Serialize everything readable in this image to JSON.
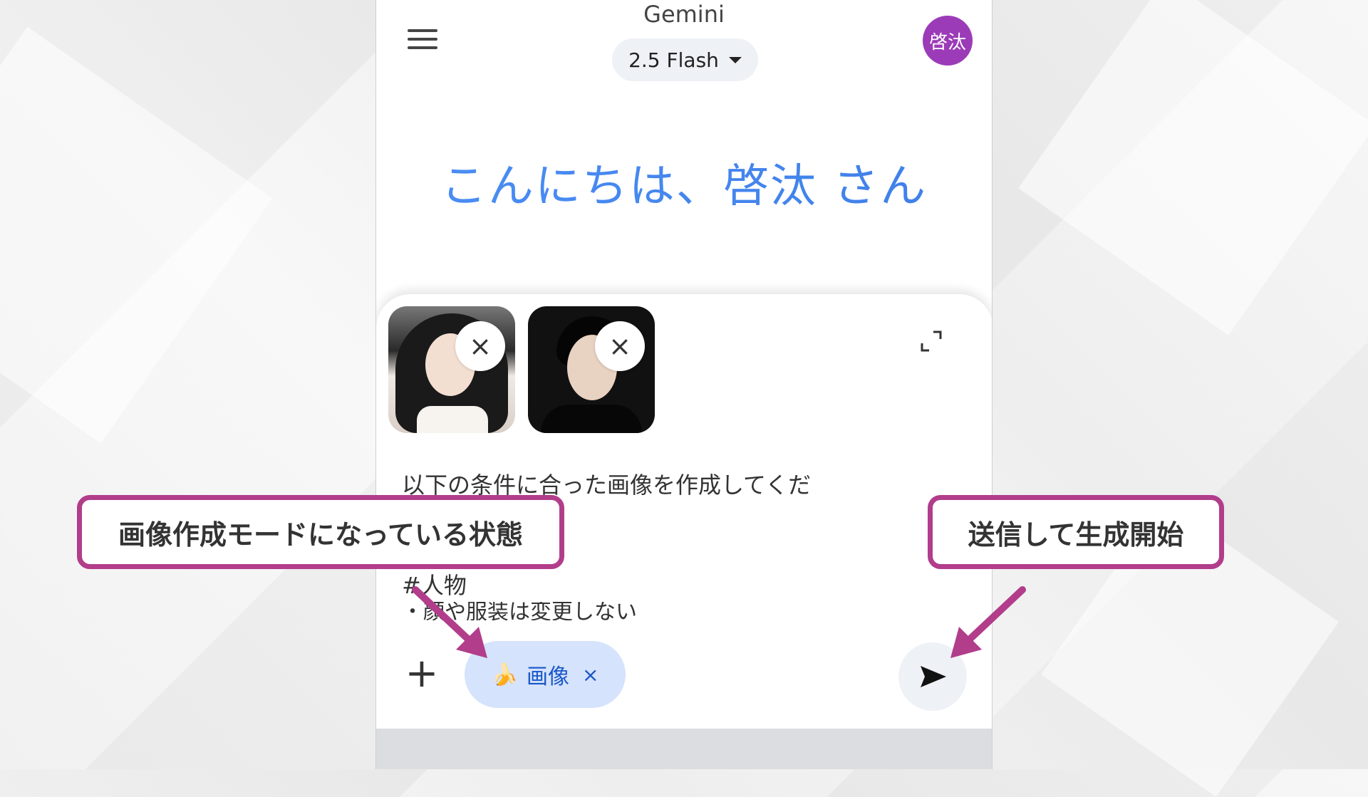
{
  "app": {
    "title": "Gemini",
    "model_label": "2.5 Flash",
    "avatar_text": "啓汰",
    "greeting": "こんにちは、啓汰 さん"
  },
  "attachments": [
    {
      "remove_label": "×"
    },
    {
      "remove_label": "×"
    }
  ],
  "prompt": {
    "line1": "以下の条件に合った画像を作成してくだ",
    "line2": "#人物",
    "line3": "・顔や服装は変更しない"
  },
  "toolbar": {
    "add_label": "+",
    "mode_chip_label": "画像",
    "mode_chip_icon": "banana-icon",
    "mode_chip_close": "×",
    "send_icon": "send-icon"
  },
  "annotations": {
    "left": "画像作成モードになっている状態",
    "right": "送信して生成開始",
    "color": "#b13d8b"
  },
  "colors": {
    "greeting": "#4285f4",
    "avatar": "#9c3bb8",
    "chip_bg": "#d5e3fc",
    "chip_text": "#1a57c9"
  }
}
